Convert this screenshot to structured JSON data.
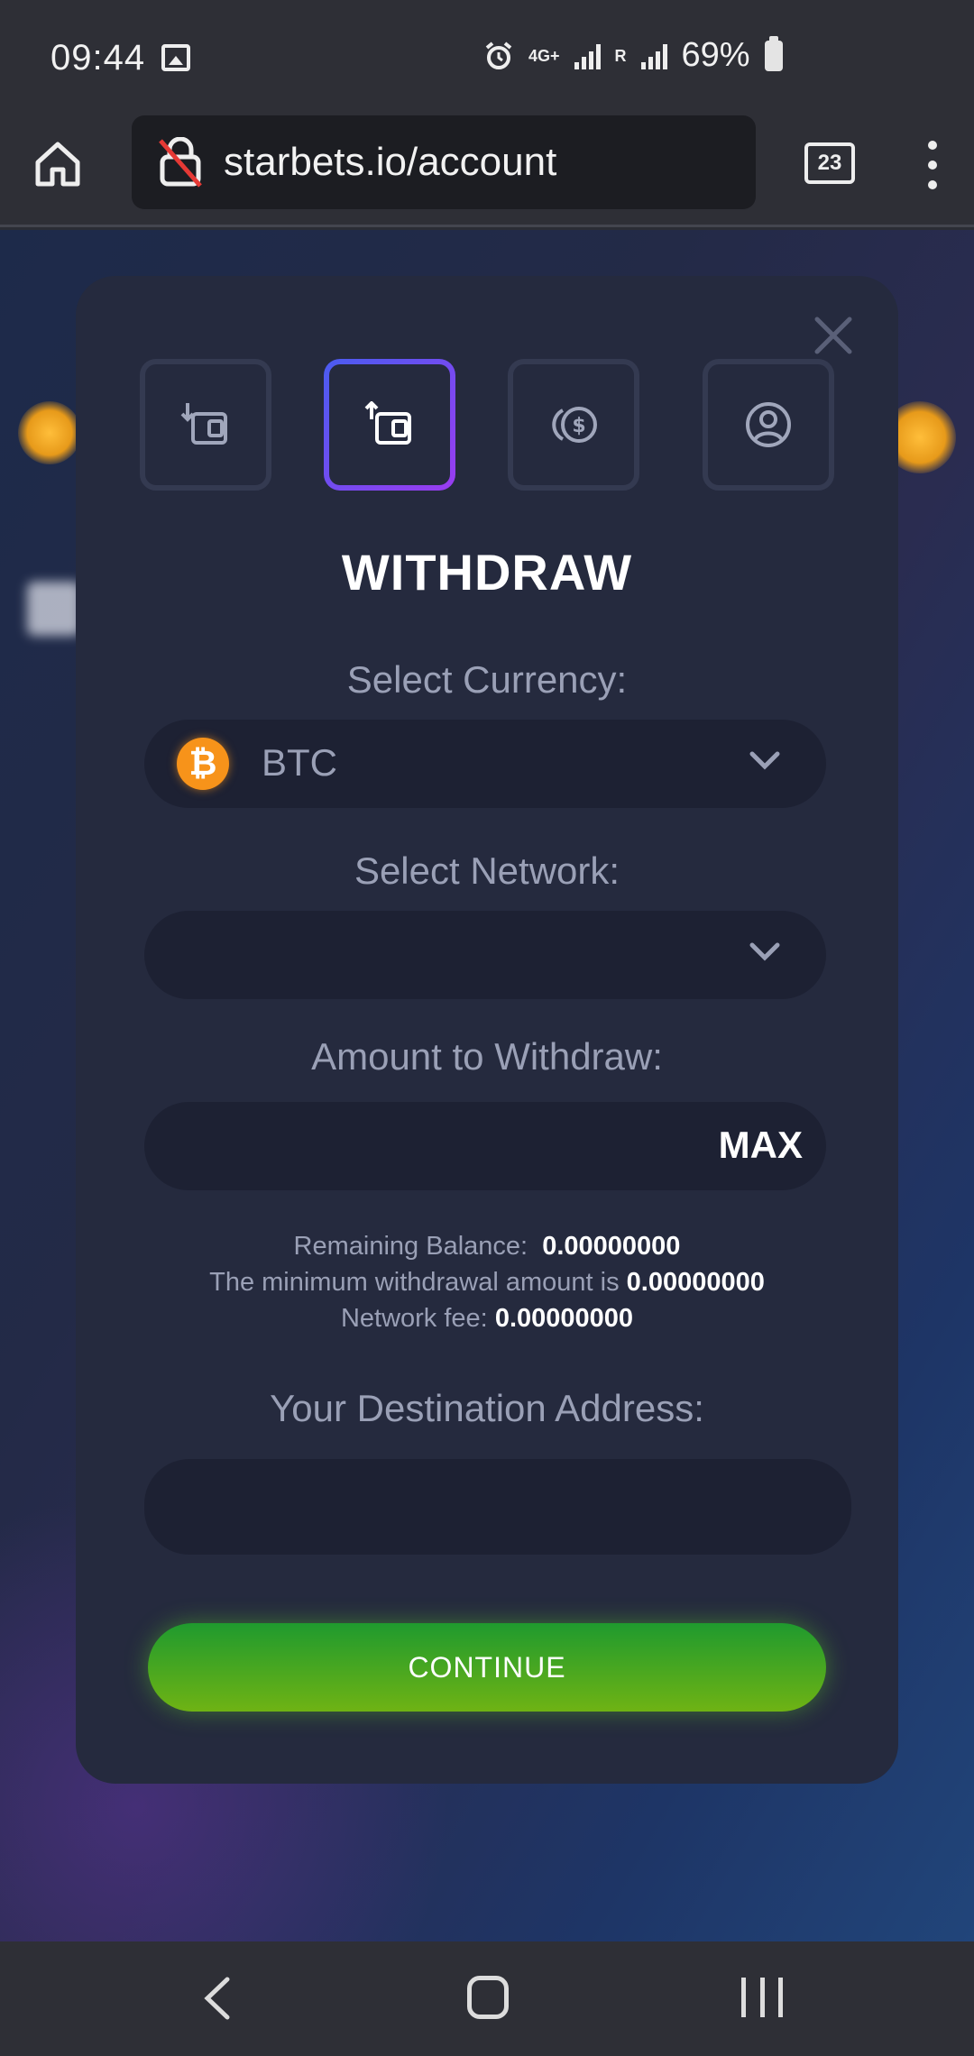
{
  "status_bar": {
    "time": "09:44",
    "network": "4G+",
    "roaming": "R",
    "battery": "69%"
  },
  "browser": {
    "url": "starbets.io/account",
    "tab_count": "23"
  },
  "modal": {
    "tabs": [
      {
        "name": "deposit",
        "icon": "wallet-deposit-icon",
        "active": false
      },
      {
        "name": "withdraw",
        "icon": "wallet-withdraw-icon",
        "active": true
      },
      {
        "name": "exchange",
        "icon": "coin-exchange-icon",
        "active": false
      },
      {
        "name": "profile",
        "icon": "user-circle-icon",
        "active": false
      }
    ],
    "title": "WITHDRAW",
    "currency_label": "Select Currency:",
    "currency_value": "BTC",
    "network_label": "Select Network:",
    "network_value": "",
    "amount_label": "Amount to Withdraw:",
    "max_label": "MAX",
    "remaining_label": "Remaining Balance:",
    "remaining_value": "0.00000000",
    "minimum_label": "The minimum withdrawal amount is",
    "minimum_value": "0.00000000",
    "fee_label": "Network fee:",
    "fee_value": "0.00000000",
    "address_label": "Your Destination Address:",
    "continue_label": "CONTINUE"
  },
  "colors": {
    "accent_gradient_start": "#4a5cf0",
    "accent_gradient_end": "#9a3cf0",
    "button_green": "#1f9a2e",
    "button_lime": "#6fb314",
    "btc_orange": "#f7931a"
  }
}
